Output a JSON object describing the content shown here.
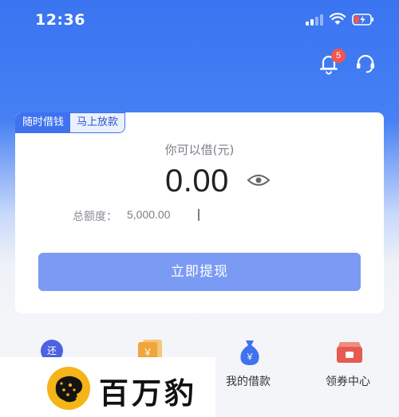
{
  "status_bar": {
    "time": "12:36"
  },
  "header": {
    "notification_count": "5"
  },
  "card": {
    "tag_primary": "随时借钱",
    "tag_secondary": "马上放款",
    "borrow_label": "你可以借(元)",
    "amount": "0.00",
    "limit_label": "总额度：",
    "limit_value": "5,000.00",
    "withdraw_button": "立即提现"
  },
  "menu": [
    {
      "label": "",
      "icon": "repay-icon",
      "icon_text": "还"
    },
    {
      "label": "",
      "icon": "bill-icon",
      "icon_text": "￥"
    },
    {
      "label": "我的借款",
      "icon": "money-bag-icon",
      "icon_text": "￥"
    },
    {
      "label": "领券中心",
      "icon": "coupon-icon"
    }
  ],
  "brand": {
    "name": "百万豹"
  },
  "colors": {
    "primary": "#3f72ee",
    "button": "#7b9af3",
    "badge": "#f2564f",
    "coupon": "#e65a4f"
  }
}
